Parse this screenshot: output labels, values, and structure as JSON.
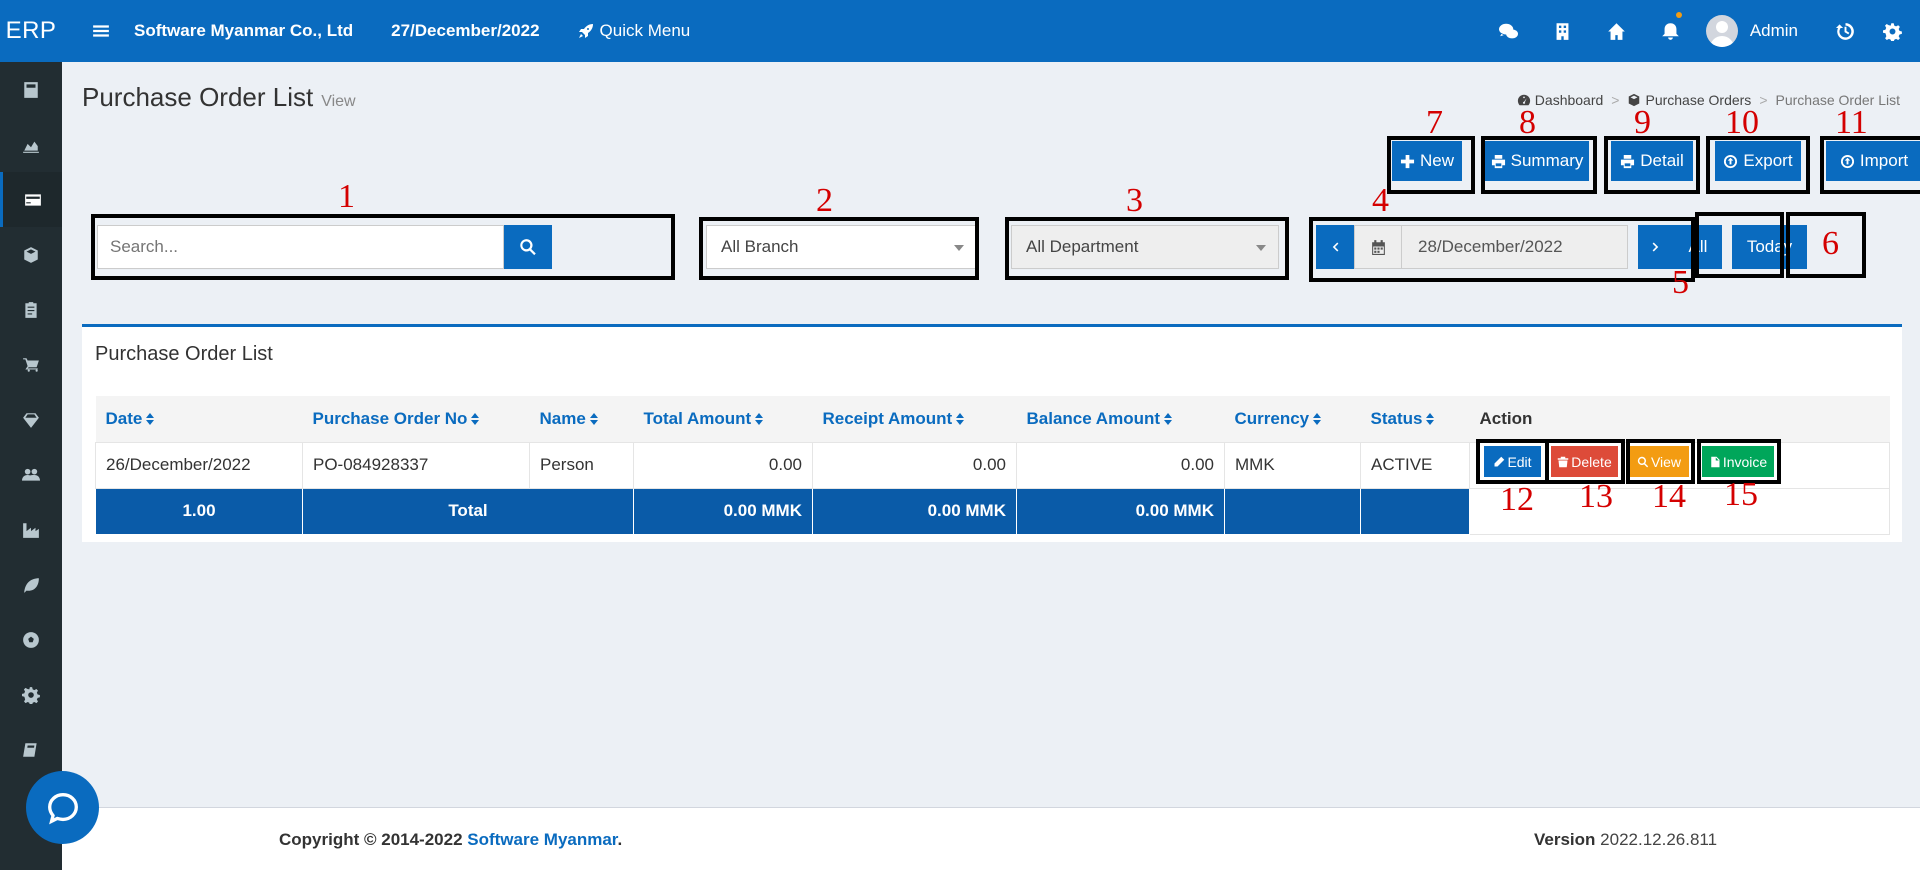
{
  "app": {
    "logo": "ERP"
  },
  "header": {
    "company": "Software Myanmar Co., Ltd",
    "date": "27/December/2022",
    "quick_menu": "Quick Menu",
    "user": "Admin"
  },
  "sidebar": {
    "items": [
      "calculator-icon",
      "chart-area-icon",
      "credit-card-icon",
      "cube-icon",
      "clipboard-icon",
      "cart-icon",
      "diamond-icon",
      "users-icon",
      "industry-icon",
      "leaf-icon",
      "soccer-icon",
      "gear-icon",
      "book-icon"
    ]
  },
  "page": {
    "title": "Purchase Order List",
    "subtitle": "View"
  },
  "breadcrumb": {
    "home": "Dashboard",
    "section": "Purchase Orders",
    "current": "Purchase Order List"
  },
  "toolbar": {
    "new": "New",
    "summary": "Summary",
    "detail": "Detail",
    "export": "Export",
    "import": "Import"
  },
  "filters": {
    "search_placeholder": "Search...",
    "branch": "All Branch",
    "department": "All Department",
    "date": "28/December/2022",
    "all": "All",
    "today": "Today"
  },
  "annotations": [
    "1",
    "2",
    "3",
    "4",
    "5",
    "6",
    "7",
    "8",
    "9",
    "10",
    "11",
    "12",
    "13",
    "14",
    "15"
  ],
  "table": {
    "box_title": "Purchase Order List",
    "headers": [
      "Date",
      "Purchase Order No",
      "Name",
      "Total Amount",
      "Receipt Amount",
      "Balance Amount",
      "Currency",
      "Status",
      "Action"
    ],
    "row": {
      "date": "26/December/2022",
      "po_no": "PO-084928337",
      "name": "Person",
      "total": "0.00",
      "receipt": "0.00",
      "balance": "0.00",
      "currency": "MMK",
      "status": "ACTIVE"
    },
    "actions": {
      "edit": "Edit",
      "delete": "Delete",
      "view": "View",
      "invoice": "Invoice"
    },
    "totals": {
      "count": "1.00",
      "label": "Total",
      "total": "0.00 MMK",
      "receipt": "0.00 MMK",
      "balance": "0.00 MMK"
    }
  },
  "footer": {
    "copyright": "Copyright © 2014-2022 ",
    "company_link": "Software Myanmar",
    "period": ".",
    "version_label": "Version",
    "version": "2022.12.26.811"
  },
  "colors": {
    "primary": "#0a6bbf",
    "danger": "#dd4b39",
    "warning": "#f39c12",
    "success": "#00a65a",
    "annotation": "#d40000"
  }
}
